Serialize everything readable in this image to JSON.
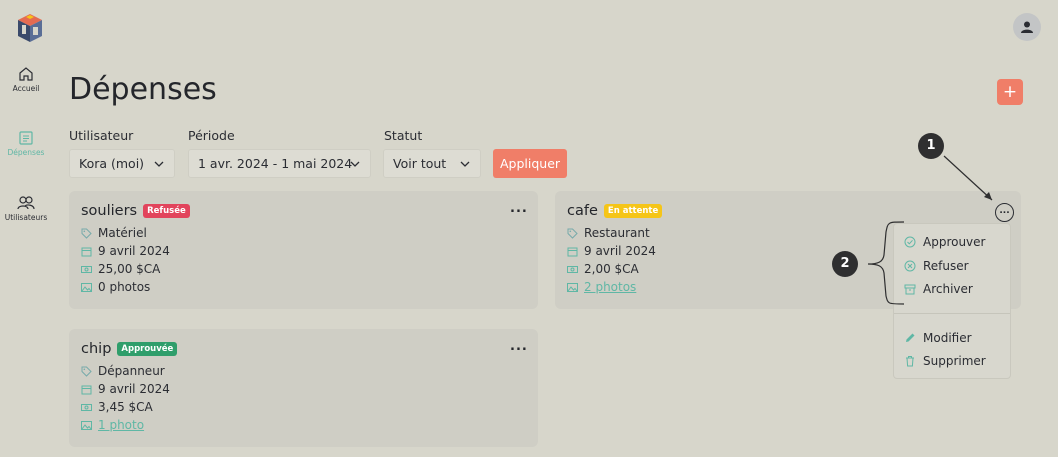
{
  "nav": {
    "home_label": "Accueil",
    "expenses_label": "Dépenses",
    "users_label": "Utilisateurs"
  },
  "header": {
    "title": "Dépenses",
    "add_label": "+"
  },
  "filters": {
    "user_label": "Utilisateur",
    "user_value": "Kora (moi)",
    "period_label": "Période",
    "period_value": "1 avr. 2024 - 1 mai 2024",
    "status_label": "Statut",
    "status_value": "Voir tout",
    "apply_label": "Appliquer"
  },
  "cards": [
    {
      "title": "souliers",
      "status": "Refusée",
      "status_color": "#e2445c",
      "category": "Matériel",
      "date": "9 avril 2024",
      "amount": "25,00 $CA",
      "photos": "0 photos",
      "more": "..."
    },
    {
      "title": "cafe",
      "status": "En attente",
      "status_color": "#f5c518",
      "category": "Restaurant",
      "date": "9 avril 2024",
      "amount": "2,00 $CA",
      "photos": "2 photos",
      "more": "..."
    },
    {
      "title": "chip",
      "status": "Approuvée",
      "status_color": "#2f9e6b",
      "category": "Dépanneur",
      "date": "9 avril 2024",
      "amount": "3,45 $CA",
      "photos": "1 photo",
      "more": "..."
    }
  ],
  "menu": {
    "approve": "Approuver",
    "reject": "Refuser",
    "archive": "Archiver",
    "edit": "Modifier",
    "delete": "Supprimer"
  },
  "callouts": [
    "1",
    "2"
  ],
  "colors": {
    "accent": "#f07e68",
    "teal": "#5fb7a5"
  }
}
